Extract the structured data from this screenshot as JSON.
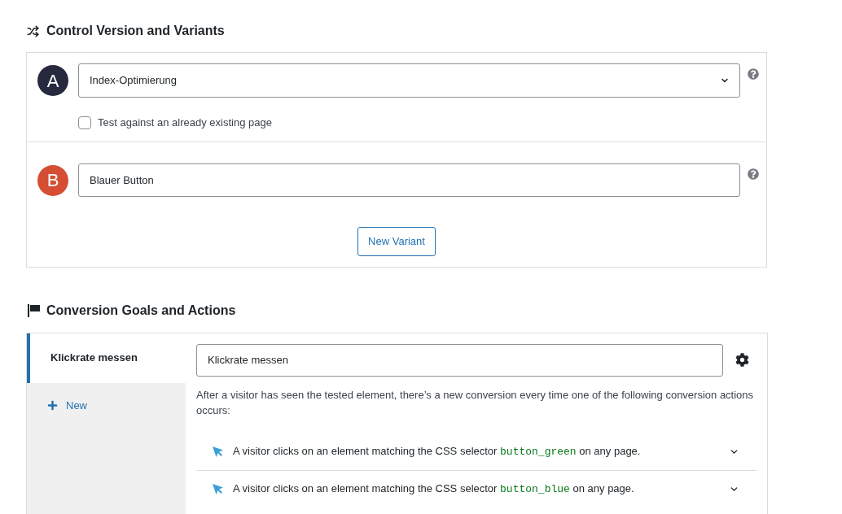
{
  "control_section": {
    "title": "Control Version and Variants",
    "variants": [
      {
        "letter": "A",
        "color": "#272a3f",
        "kind": "select",
        "value": "Index-Optimierung",
        "checkbox": {
          "label": "Test against an already existing page",
          "checked": false
        }
      },
      {
        "letter": "B",
        "color": "#d54e33",
        "kind": "input",
        "value": "Blauer Button"
      }
    ],
    "new_variant_button": "New Variant"
  },
  "goals_section": {
    "title": "Conversion Goals and Actions",
    "tabs": [
      {
        "label": "Klickrate messen",
        "selected": true
      }
    ],
    "new_button": "New",
    "goal_name": {
      "value": "Klickrate messen"
    },
    "description": "After a visitor has seen the tested element, there’s a new conversion every time one of the following conversion actions occurs:",
    "actions": [
      {
        "text_before": "A visitor clicks on an element matching the CSS selector ",
        "selector": "button_green",
        "text_after": " on any page.",
        "expanded": false
      },
      {
        "text_before": "A visitor clicks on an element matching the CSS selector ",
        "selector": "button_blue",
        "text_after": " on any page.",
        "expanded": false
      }
    ]
  }
}
